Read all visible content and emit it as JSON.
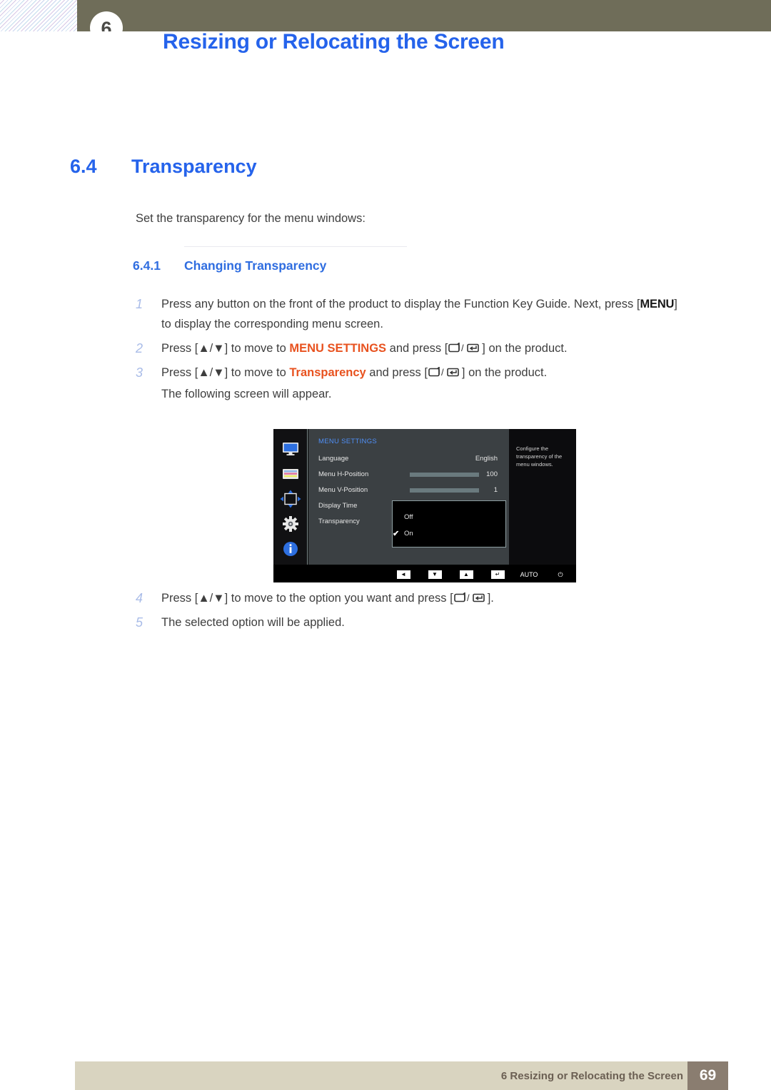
{
  "header": {
    "chapter_number": "6",
    "title": "Resizing or Relocating the Screen"
  },
  "section": {
    "number": "6.4",
    "title": "Transparency",
    "intro": "Set the transparency for the menu windows:"
  },
  "subsection": {
    "number": "6.4.1",
    "title": "Changing Transparency"
  },
  "steps": [
    {
      "marker": "1",
      "pre": "Press any button on the front of the product to display the Function Key Guide. Next, press [",
      "key": "MENU",
      "post": "]",
      "second_line": "to display the corresponding menu screen."
    },
    {
      "marker": "2",
      "pre": "Press [▲/▼] to move to ",
      "highlight": "MENU SETTINGS",
      "mid": " and press [",
      "post": "] on the product."
    },
    {
      "marker": "3",
      "pre": "Press [▲/▼] to move to ",
      "highlight": "Transparency",
      "mid": " and press [",
      "post": "] on the product.",
      "second_line": "The following screen will appear."
    },
    {
      "marker": "4",
      "pre": "Press [▲/▼] to move to the option you want and press [",
      "post": "]."
    },
    {
      "marker": "5",
      "pre": "The selected option will be applied."
    }
  ],
  "osd": {
    "title": "MENU SETTINGS",
    "icons": [
      "monitor-icon",
      "picture-color-icon",
      "position-arrows-icon",
      "gear-icon",
      "info-icon"
    ],
    "rows": [
      {
        "label": "Language",
        "value": "English",
        "bar": null
      },
      {
        "label": "Menu H-Position",
        "value": "100",
        "bar": 100
      },
      {
        "label": "Menu V-Position",
        "value": "1",
        "bar": 4
      },
      {
        "label": "Display Time",
        "value": "",
        "bar": null
      },
      {
        "label": "Transparency",
        "value": "",
        "bar": null
      }
    ],
    "popup": {
      "options": [
        {
          "label": "Off",
          "checked": false
        },
        {
          "label": "On",
          "checked": true
        }
      ],
      "check_glyph": "✔"
    },
    "help_text": "Configure the transparency of the menu windows.",
    "buttons": [
      {
        "name": "left-arrow-button",
        "glyph": "◄"
      },
      {
        "name": "down-arrow-button",
        "glyph": "▼"
      },
      {
        "name": "up-arrow-button",
        "glyph": "▲"
      },
      {
        "name": "enter-button",
        "glyph": "↵"
      },
      {
        "name": "auto-button",
        "glyph": "AUTO"
      },
      {
        "name": "power-button",
        "glyph": "⏻"
      }
    ]
  },
  "footer": {
    "text": "6 Resizing or Relocating the Screen",
    "page": "69"
  },
  "colors": {
    "heading_blue": "#2563eb",
    "highlight_orange": "#e8521f",
    "header_olive": "#6f6d59",
    "footer_band": "#d9d4c0",
    "footer_page_box": "#8a7d70",
    "osd_title_blue": "#4f8ff7"
  }
}
